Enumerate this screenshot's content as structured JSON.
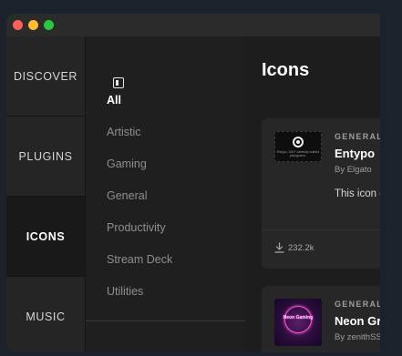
{
  "window": {
    "controls": [
      "close",
      "minimize",
      "maximize"
    ]
  },
  "nav": {
    "items": [
      {
        "label": "DISCOVER"
      },
      {
        "label": "PLUGINS"
      },
      {
        "label": "ICONS"
      },
      {
        "label": "MUSIC"
      }
    ],
    "active": "ICONS"
  },
  "categories": {
    "collapse_icon": "sidebar-toggle-icon",
    "items": [
      {
        "label": "All"
      },
      {
        "label": "Artistic"
      },
      {
        "label": "Gaming"
      },
      {
        "label": "General"
      },
      {
        "label": "Productivity"
      },
      {
        "label": "Stream Deck"
      },
      {
        "label": "Utilities"
      }
    ],
    "active": "All"
  },
  "main": {
    "title": "Icons",
    "cards": [
      {
        "category": "GENERAL",
        "name": "Entypo",
        "author": "By Elgato",
        "description": "This icon carefully",
        "thumb_text": "Entypo, 400+ carefully crafted pictograms.",
        "downloads": "232.2k"
      },
      {
        "category": "GENERAL",
        "name": "Neon Gr",
        "author": "By zenithSS",
        "thumb_text": "Neon Gaming"
      }
    ]
  },
  "colors": {
    "background": "#1c222c",
    "window": "#1d1d1d",
    "nav_active": "#191919",
    "card": "#272727",
    "neon_accent": "#ff4fd8"
  }
}
